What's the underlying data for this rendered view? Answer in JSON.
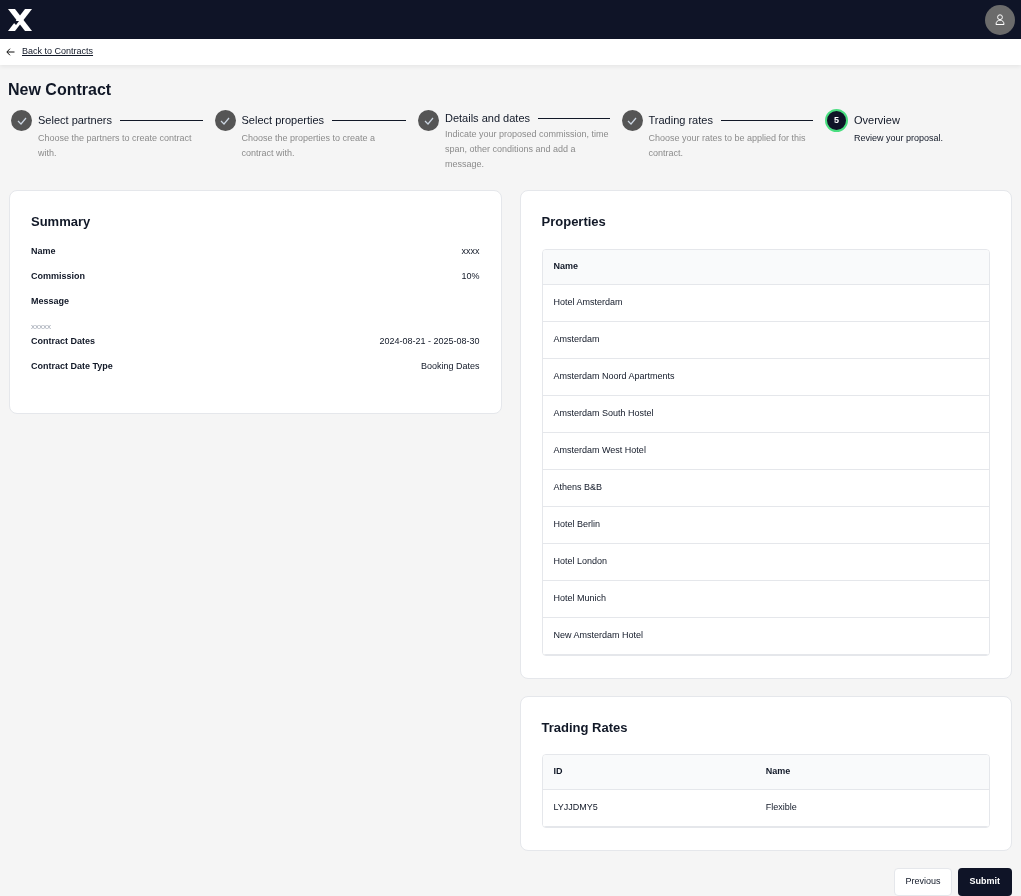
{
  "header": {
    "back_link": "Back to Contracts"
  },
  "title": "New Contract",
  "steps": [
    {
      "title": "Select partners",
      "description": "Choose the partners to create contract with.",
      "done": true
    },
    {
      "title": "Select properties",
      "description": "Choose the properties to create a contract with.",
      "done": true
    },
    {
      "title": "Details and dates",
      "description": "Indicate your proposed commission, time span, other conditions and add a message.",
      "done": true
    },
    {
      "title": "Trading rates",
      "description": "Choose your rates to be applied for this contract.",
      "done": true
    },
    {
      "title": "Overview",
      "description": "Review your proposal.",
      "done": false,
      "number": "5"
    }
  ],
  "summary": {
    "title": "Summary",
    "rows": [
      {
        "kind": "inline",
        "label": "Name",
        "value": "xxxx"
      },
      {
        "kind": "inline",
        "label": "Commission",
        "value": "10%"
      },
      {
        "kind": "block",
        "label": "Message",
        "value": "xxxxx"
      },
      {
        "kind": "inline",
        "label": "Contract Dates",
        "value": "2024-08-21 - 2025-08-30"
      },
      {
        "kind": "inline",
        "label": "Contract Date Type",
        "value": "Booking Dates"
      }
    ]
  },
  "properties": {
    "title": "Properties",
    "columns": [
      "Name"
    ],
    "rows": [
      [
        "Hotel Amsterdam"
      ],
      [
        "Amsterdam"
      ],
      [
        "Amsterdam Noord Apartments"
      ],
      [
        "Amsterdam South Hostel"
      ],
      [
        "Amsterdam West Hotel"
      ],
      [
        "Athens B&B"
      ],
      [
        "Hotel Berlin"
      ],
      [
        "Hotel London"
      ],
      [
        "Hotel Munich"
      ],
      [
        "New Amsterdam Hotel"
      ]
    ]
  },
  "trading_rates": {
    "title": "Trading Rates",
    "columns": [
      "ID",
      "Name"
    ],
    "rows": [
      [
        "LYJJDMY5",
        "Flexible"
      ]
    ]
  },
  "buttons": {
    "previous": "Previous",
    "submit": "Submit"
  }
}
